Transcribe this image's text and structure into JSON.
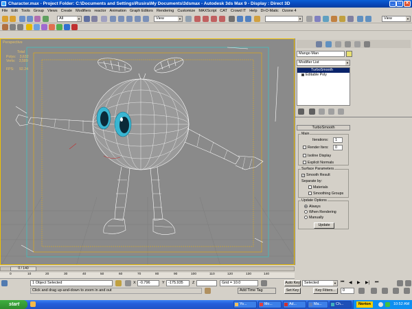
{
  "window": {
    "title": "Character.max    - Project Folder: C:\\Documents and Settings\\Rusira\\My Documents\\3dsmax    - Autodesk 3ds Max 9    - Display : Direct 3D",
    "minimize": "_",
    "maximize": "□",
    "close": "✕"
  },
  "menu": [
    "File",
    "Edit",
    "Tools",
    "Group",
    "Views",
    "Create",
    "Modifiers",
    "reactor",
    "Animation",
    "Graph Editors",
    "Rendering",
    "Customize",
    "MAXScript",
    "CAT",
    "Crowd IT",
    "Help",
    "Di-O-Matic",
    "Ozone 4"
  ],
  "toolbar": {
    "selection_filter": "All",
    "ref_coord": "View",
    "named_sel": "",
    "right_view": "View"
  },
  "viewport": {
    "label": "Perspective",
    "stats": {
      "total_label": "Total",
      "polys_label": "Polys:",
      "polys": "3,632",
      "verts_label": "Verts:",
      "verts": "3,589",
      "fps_label": "FPS:",
      "fps": "92.24"
    }
  },
  "command_panel": {
    "object_name": "Mango Man",
    "modifier_list": "Modifier List",
    "stack": [
      "TurboSmooth",
      "Editable Poly"
    ],
    "rollout_title": "TurboSmooth",
    "main_group": "Main",
    "iterations_label": "Iterations:",
    "iterations": "1",
    "render_iters_label": "Render Iters:",
    "render_iters": "0",
    "isoline": "Isoline Display",
    "explicit": "Explicit Normals",
    "surface_group": "Surface Parameters",
    "smooth_result": "Smooth Result",
    "separate_by": "Separate by:",
    "materials": "Materials",
    "smoothing_groups": "Smoothing Groups",
    "update_group": "Update Options",
    "always": "Always",
    "when_rendering": "When Rendering",
    "manually": "Manually",
    "update_button": "Update"
  },
  "timeline": {
    "frame": "0 / 140",
    "ticks": [
      "0",
      "10",
      "20",
      "30",
      "40",
      "50",
      "60",
      "70",
      "80",
      "90",
      "100",
      "110",
      "120",
      "130",
      "140"
    ],
    "status": "1 Object Selected",
    "prompt": "Click and drag up-and-down to zoom in and out",
    "x_label": "X",
    "x": "-0.796",
    "y_label": "Y",
    "y": "-175.935",
    "z_label": "Z",
    "z": "",
    "grid": "Grid = 10.0",
    "add_time_tag": "Add Time Tag",
    "auto_key": "Auto Key",
    "set_key": "Set Key",
    "selected": "Selected",
    "key_filters": "Key Filters...",
    "current_frame": "0"
  },
  "taskbar": {
    "start": "start",
    "tasks": [
      "Yo...",
      "Mo...",
      "Ad...",
      "Ma...",
      "Ch..."
    ],
    "norton": "Norton",
    "clock": "10:52 AM"
  },
  "colors": {
    "viewport_bg": "#8a8a8a",
    "viewport_border": "#f0c000",
    "wireframe": "#ffffff",
    "eye_color": "#39b6d2"
  }
}
